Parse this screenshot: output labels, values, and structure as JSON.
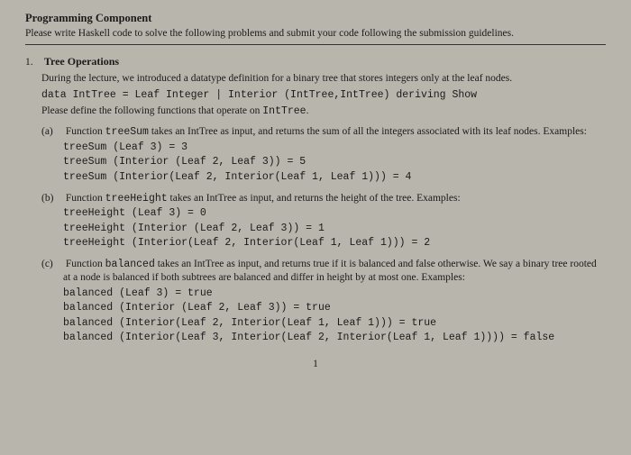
{
  "header": {
    "title": "Programming Component",
    "desc": "Please write Haskell code to solve the following problems and submit your code following the submission guidelines."
  },
  "problem": {
    "num": "1.",
    "title": "Tree Operations",
    "intro": "During the lecture, we introduced a datatype definition for a binary tree that stores integers only at the leaf nodes.",
    "datadef": "data IntTree = Leaf Integer | Interior (IntTree,IntTree) deriving Show",
    "instruction": "Please define the following functions that operate on ",
    "instruction_code": "IntTree",
    "instruction_end": "."
  },
  "sub_a": {
    "label": "(a)",
    "desc1": "Function ",
    "fn": "treeSum",
    "desc2": " takes an IntTree as input, and returns the sum of all the integers associated with its leaf nodes. Examples:",
    "ex1": "treeSum (Leaf 3) = 3",
    "ex2": "treeSum (Interior (Leaf 2, Leaf 3)) = 5",
    "ex3": "treeSum (Interior(Leaf 2, Interior(Leaf 1, Leaf 1))) = 4"
  },
  "sub_b": {
    "label": "(b)",
    "desc1": "Function ",
    "fn": "treeHeight",
    "desc2": " takes an IntTree as input, and returns the height of the tree. Examples:",
    "ex1": "treeHeight (Leaf 3) = 0",
    "ex2": "treeHeight (Interior (Leaf 2, Leaf 3)) = 1",
    "ex3": "treeHeight (Interior(Leaf 2, Interior(Leaf 1, Leaf 1))) = 2"
  },
  "sub_c": {
    "label": "(c)",
    "desc1": "Function ",
    "fn": "balanced",
    "desc2": " takes an IntTree as input, and returns true if it is balanced and false otherwise. We say a binary tree rooted at a node is balanced if both subtrees are balanced and differ in height by at most one. Examples:",
    "ex1": "balanced (Leaf 3) = true",
    "ex2": "balanced (Interior (Leaf 2, Leaf 3)) = true",
    "ex3": "balanced (Interior(Leaf 2, Interior(Leaf 1, Leaf 1))) = true",
    "ex4": "balanced (Interior(Leaf 3, Interior(Leaf 2, Interior(Leaf 1, Leaf 1)))) = false"
  },
  "page_num": "1"
}
